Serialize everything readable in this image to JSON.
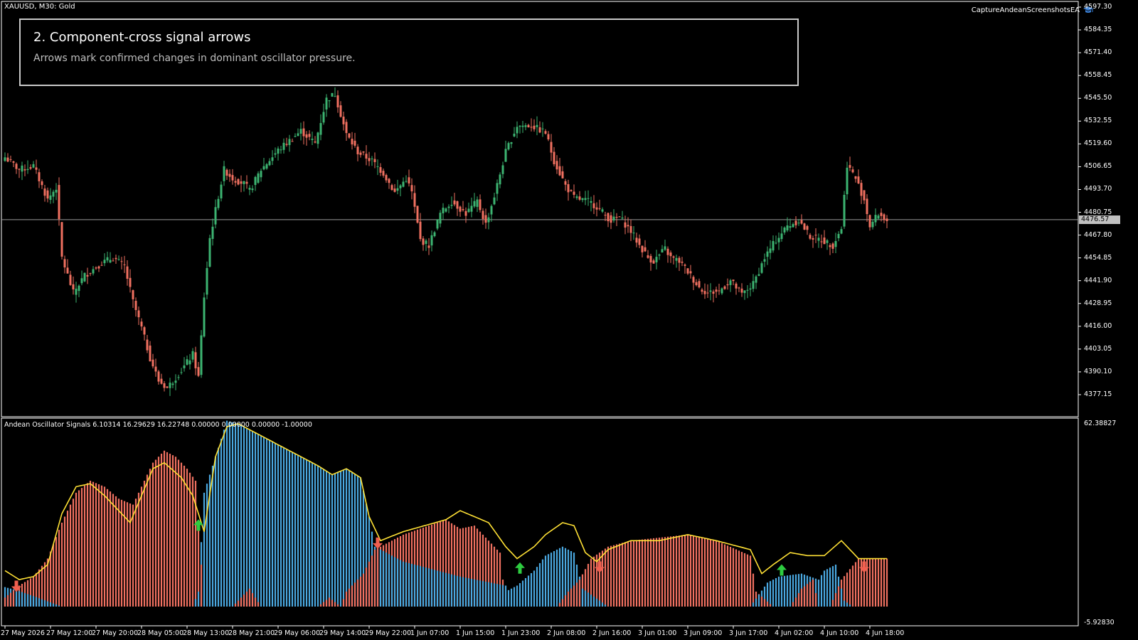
{
  "chart_window": {
    "symbol_label": "XAUUSD, M30:  Gold",
    "ea_name": "CaptureAndeanScreenshotsEA",
    "ea_icon": "graduation-cap-icon",
    "current_price_tag": "4476.57"
  },
  "info_box": {
    "title": "2. Component-cross signal arrows",
    "subtitle": "Arrows mark confirmed changes in dominant oscillator pressure."
  },
  "indicator": {
    "label": "Andean Oscillator Signals 6.10314 16.29629 16.22748 0.00000 0.00000 0.00000 -1.00000",
    "axis_top": "62.38827",
    "axis_bottom": "-5.92830"
  },
  "price_axis_labels": [
    "4597.30",
    "4584.35",
    "4571.40",
    "4558.45",
    "4545.50",
    "4532.55",
    "4519.60",
    "4506.65",
    "4493.70",
    "4480.75",
    "4467.80",
    "4454.85",
    "4441.90",
    "4428.95",
    "4416.00",
    "4403.05",
    "4390.10",
    "4377.15"
  ],
  "time_axis_labels": [
    "27 May 2026",
    "27 May 12:00",
    "27 May 20:00",
    "28 May 05:00",
    "28 May 13:00",
    "28 May 21:00",
    "29 May 06:00",
    "29 May 14:00",
    "29 May 22:00",
    "1 Jun 07:00",
    "1 Jun 15:00",
    "1 Jun 23:00",
    "2 Jun 08:00",
    "2 Jun 16:00",
    "3 Jun 01:00",
    "3 Jun 09:00",
    "3 Jun 17:00",
    "4 Jun 02:00",
    "4 Jun 10:00",
    "4 Jun 18:00"
  ],
  "colors": {
    "bull_candle": "#3cb371",
    "bear_candle": "#f07060",
    "bull_histogram": "#4aa8e0",
    "bear_histogram": "#f07060",
    "signal_line": "#ffe135",
    "up_arrow": "#2ecc40",
    "down_arrow": "#f06050",
    "grid_border": "#ffffff"
  },
  "chart_data": [
    {
      "type": "candlestick",
      "title": "XAUUSD, M30:  Gold",
      "ylim": [
        4371.0,
        4600.0
      ],
      "current_price": 4476.57,
      "anchors": [
        [
          0,
          4512
        ],
        [
          5,
          4505
        ],
        [
          10,
          4507
        ],
        [
          15,
          4488
        ],
        [
          18,
          4495
        ],
        [
          20,
          4455
        ],
        [
          24,
          4435
        ],
        [
          28,
          4445
        ],
        [
          34,
          4452
        ],
        [
          38,
          4455
        ],
        [
          42,
          4450
        ],
        [
          45,
          4430
        ],
        [
          48,
          4415
        ],
        [
          51,
          4398
        ],
        [
          54,
          4385
        ],
        [
          57,
          4381
        ],
        [
          62,
          4391
        ],
        [
          66,
          4400
        ],
        [
          68,
          4387
        ],
        [
          70,
          4433
        ],
        [
          72,
          4466
        ],
        [
          75,
          4490
        ],
        [
          77,
          4505
        ],
        [
          80,
          4500
        ],
        [
          84,
          4497
        ],
        [
          86,
          4493
        ],
        [
          90,
          4505
        ],
        [
          96,
          4516
        ],
        [
          104,
          4527
        ],
        [
          109,
          4520
        ],
        [
          113,
          4545
        ],
        [
          116,
          4548
        ],
        [
          120,
          4525
        ],
        [
          124,
          4515
        ],
        [
          129,
          4510
        ],
        [
          133,
          4503
        ],
        [
          137,
          4492
        ],
        [
          141,
          4500
        ],
        [
          143,
          4492
        ],
        [
          146,
          4465
        ],
        [
          149,
          4462
        ],
        [
          153,
          4480
        ],
        [
          157,
          4487
        ],
        [
          162,
          4480
        ],
        [
          166,
          4487
        ],
        [
          169,
          4474
        ],
        [
          172,
          4490
        ],
        [
          176,
          4515
        ],
        [
          180,
          4530
        ],
        [
          185,
          4530
        ],
        [
          190,
          4526
        ],
        [
          193,
          4510
        ],
        [
          197,
          4496
        ],
        [
          200,
          4489
        ],
        [
          205,
          4487
        ],
        [
          208,
          4484
        ],
        [
          213,
          4476
        ],
        [
          216,
          4478
        ],
        [
          220,
          4470
        ],
        [
          223,
          4462
        ],
        [
          226,
          4455
        ],
        [
          228,
          4453
        ],
        [
          232,
          4460
        ],
        [
          234,
          4455
        ],
        [
          237,
          4453
        ],
        [
          240,
          4447
        ],
        [
          244,
          4438
        ],
        [
          247,
          4435
        ],
        [
          251,
          4436
        ],
        [
          255,
          4442
        ],
        [
          259,
          4434
        ],
        [
          263,
          4440
        ],
        [
          267,
          4455
        ],
        [
          271,
          4465
        ],
        [
          275,
          4473
        ],
        [
          279,
          4476
        ],
        [
          283,
          4467
        ],
        [
          287,
          4465
        ],
        [
          291,
          4462
        ],
        [
          294,
          4472
        ],
        [
          296,
          4508
        ],
        [
          299,
          4500
        ],
        [
          302,
          4488
        ],
        [
          304,
          4473
        ],
        [
          307,
          4480
        ],
        [
          310,
          4476
        ]
      ]
    },
    {
      "type": "bar",
      "title": "Andean Oscillator Signals",
      "ylim": [
        -5.9283,
        62.38827
      ],
      "series": [
        {
          "name": "bull_component",
          "anchors": [
            [
              0,
              6.5
            ],
            [
              4,
              5.5
            ],
            [
              10,
              3.5
            ],
            [
              20,
              0
            ],
            [
              60,
              0
            ],
            [
              66,
              0
            ],
            [
              68,
              5
            ],
            [
              70,
              38
            ],
            [
              74,
              50
            ],
            [
              78,
              62
            ],
            [
              82,
              61
            ],
            [
              90,
              57
            ],
            [
              100,
              52
            ],
            [
              110,
              47
            ],
            [
              115,
              44
            ],
            [
              120,
              46
            ],
            [
              125,
              43
            ],
            [
              128,
              30
            ],
            [
              130,
              20
            ],
            [
              140,
              15
            ],
            [
              160,
              10
            ],
            [
              176,
              7
            ],
            [
              177,
              5.5
            ],
            [
              180,
              7
            ],
            [
              186,
              12
            ],
            [
              190,
              17
            ],
            [
              196,
              20
            ],
            [
              200,
              18
            ],
            [
              203,
              6
            ],
            [
              212,
              0
            ],
            [
              262,
              0
            ],
            [
              265,
              4
            ],
            [
              268,
              8
            ],
            [
              272,
              10
            ],
            [
              280,
              11
            ],
            [
              286,
              9
            ],
            [
              288,
              12
            ],
            [
              292,
              14
            ],
            [
              295,
              2
            ],
            [
              298,
              0
            ],
            [
              310,
              0
            ]
          ]
        },
        {
          "name": "bear_component",
          "anchors": [
            [
              0,
              3
            ],
            [
              5,
              7
            ],
            [
              10,
              10
            ],
            [
              15,
              16
            ],
            [
              20,
              28
            ],
            [
              25,
              38
            ],
            [
              30,
              42
            ],
            [
              35,
              40
            ],
            [
              40,
              36
            ],
            [
              45,
              34
            ],
            [
              48,
              40
            ],
            [
              52,
              48
            ],
            [
              56,
              52
            ],
            [
              60,
              50
            ],
            [
              64,
              46
            ],
            [
              67,
              42
            ],
            [
              70,
              0
            ],
            [
              80,
              0
            ],
            [
              86,
              6
            ],
            [
              90,
              0
            ],
            [
              110,
              0
            ],
            [
              114,
              3
            ],
            [
              118,
              0
            ],
            [
              120,
              5
            ],
            [
              126,
              11
            ],
            [
              130,
              19
            ],
            [
              140,
              24
            ],
            [
              155,
              29
            ],
            [
              160,
              26
            ],
            [
              165,
              27
            ],
            [
              170,
              22
            ],
            [
              174,
              18
            ],
            [
              176,
              0
            ],
            [
              194,
              0
            ],
            [
              198,
              5
            ],
            [
              202,
              9
            ],
            [
              206,
              16
            ],
            [
              212,
              20
            ],
            [
              220,
              22
            ],
            [
              230,
              23
            ],
            [
              240,
              24
            ],
            [
              250,
              22
            ],
            [
              262,
              17
            ],
            [
              264,
              5
            ],
            [
              270,
              0
            ],
            [
              276,
              0
            ],
            [
              280,
              6
            ],
            [
              284,
              9
            ],
            [
              286,
              0
            ],
            [
              290,
              0
            ],
            [
              294,
              9
            ],
            [
              300,
              16
            ],
            [
              310,
              16
            ]
          ]
        },
        {
          "name": "signal_line",
          "anchors": [
            [
              0,
              12
            ],
            [
              5,
              9
            ],
            [
              10,
              10
            ],
            [
              15,
              14
            ],
            [
              20,
              31
            ],
            [
              25,
              40
            ],
            [
              30,
              41
            ],
            [
              35,
              37
            ],
            [
              40,
              32
            ],
            [
              44,
              28
            ],
            [
              48,
              37
            ],
            [
              52,
              46
            ],
            [
              56,
              48
            ],
            [
              62,
              43
            ],
            [
              66,
              37
            ],
            [
              70,
              25
            ],
            [
              74,
              50
            ],
            [
              78,
              60
            ],
            [
              82,
              61
            ],
            [
              90,
              57
            ],
            [
              100,
              52
            ],
            [
              110,
              47
            ],
            [
              115,
              44
            ],
            [
              120,
              46
            ],
            [
              125,
              43
            ],
            [
              128,
              30
            ],
            [
              132,
              22
            ],
            [
              140,
              25
            ],
            [
              155,
              29
            ],
            [
              160,
              32
            ],
            [
              170,
              28
            ],
            [
              176,
              20
            ],
            [
              180,
              16
            ],
            [
              186,
              20
            ],
            [
              190,
              24
            ],
            [
              196,
              28
            ],
            [
              200,
              27
            ],
            [
              204,
              18
            ],
            [
              208,
              15
            ],
            [
              212,
              19
            ],
            [
              220,
              22
            ],
            [
              230,
              22
            ],
            [
              240,
              24
            ],
            [
              250,
              22
            ],
            [
              262,
              19
            ],
            [
              266,
              11
            ],
            [
              270,
              14
            ],
            [
              276,
              18
            ],
            [
              282,
              17
            ],
            [
              288,
              17
            ],
            [
              294,
              22
            ],
            [
              300,
              16
            ],
            [
              310,
              16
            ]
          ]
        }
      ],
      "signals": [
        {
          "bar": 4,
          "direction": "down"
        },
        {
          "bar": 68,
          "direction": "up"
        },
        {
          "bar": 131,
          "direction": "down"
        },
        {
          "bar": 181,
          "direction": "up"
        },
        {
          "bar": 209,
          "direction": "down"
        },
        {
          "bar": 273,
          "direction": "up"
        },
        {
          "bar": 302,
          "direction": "down"
        }
      ]
    }
  ]
}
